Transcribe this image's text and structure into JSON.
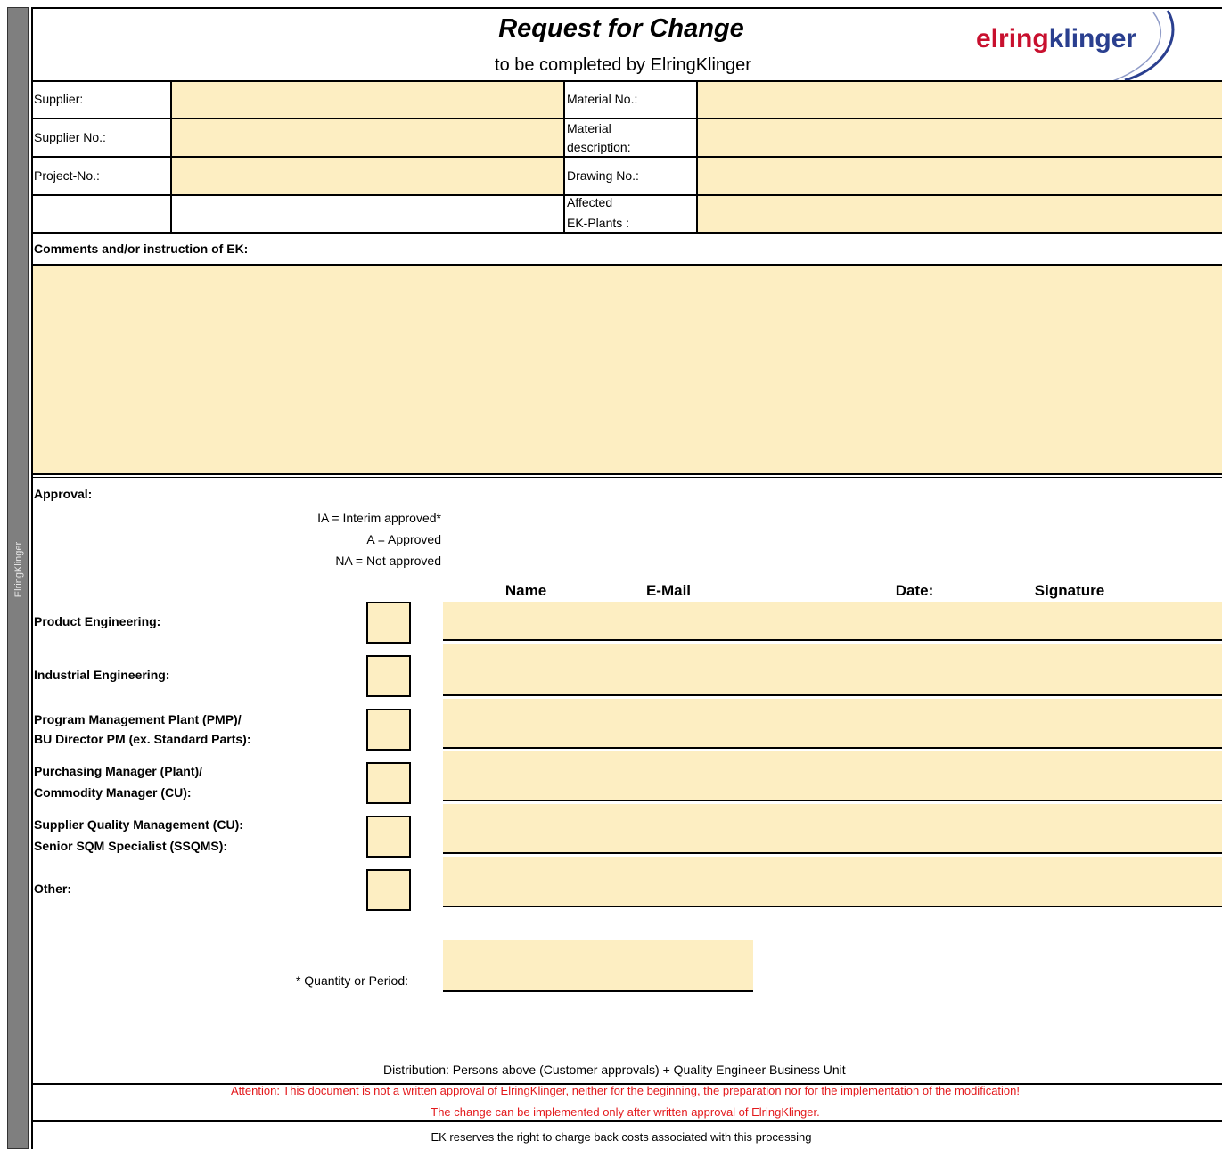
{
  "sidebar": {
    "text": "ElringKlinger"
  },
  "header": {
    "title": "Request for Change",
    "subtitle": "to be completed by ElringKlinger",
    "logo_text_a": "elring",
    "logo_text_b": "klinger",
    "colors": {
      "logo_red": "#c8102e",
      "logo_blue": "#2a3f8f"
    }
  },
  "fields": {
    "supplier": "Supplier:",
    "supplier_no": "Supplier No.:",
    "project_no": "Project-No.:",
    "material_no": "Material No.:",
    "material_desc_1": "Material",
    "material_desc_2": "description:",
    "drawing_no": "Drawing No.:",
    "affected_1": "Affected",
    "affected_2": "EK-Plants :"
  },
  "comments_label": "Comments and/or instruction of EK:",
  "approval": {
    "label": "Approval:",
    "legend": [
      "IA = Interim approved*",
      "A = Approved",
      "NA = Not approved"
    ],
    "columns": {
      "name": "Name",
      "email": "E-Mail",
      "date": "Date:",
      "signature": "Signature"
    },
    "rows": [
      {
        "line1": "Product Engineering:",
        "line2": ""
      },
      {
        "line1": "Industrial Engineering:",
        "line2": ""
      },
      {
        "line1": "Program Management Plant (PMP)/",
        "line2": "BU Director PM (ex. Standard Parts):"
      },
      {
        "line1": "Purchasing Manager (Plant)/",
        "line2": "Commodity Manager (CU):"
      },
      {
        "line1": "Supplier Quality Management (CU):",
        "line2": "Senior SQM Specialist (SSQMS):"
      },
      {
        "line1": "Other:",
        "line2": ""
      }
    ],
    "quantity_label": "* Quantity or Period:"
  },
  "footer": {
    "distribution": "Distribution: Persons above (Customer approvals) + Quality Engineer Business Unit",
    "attention_1": "Attention: This document is not a written approval of ElringKlinger, neither for the beginning, the preparation nor for the implementation of the modification!",
    "attention_2": "The change can be implemented only after written approval of ElringKlinger.",
    "reserve": "EK reserves the right to charge back costs associated with this processing"
  }
}
